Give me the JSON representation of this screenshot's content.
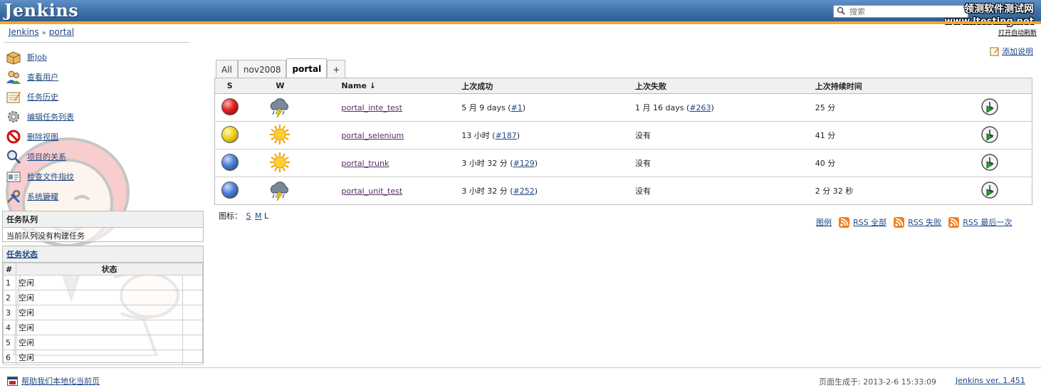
{
  "header": {
    "logo": "Jenkins",
    "search_placeholder": "搜索",
    "watermark_line1": "领测软件测试网",
    "watermark_line2": "www.ltesting.net"
  },
  "breadcrumb": {
    "root": "Jenkins",
    "separator": "»",
    "current": "portal"
  },
  "auto_refresh": "打开自动刷新",
  "sidebar": {
    "tasks": [
      {
        "label": "新Job",
        "icon": "new-package-icon"
      },
      {
        "label": "查看用户",
        "icon": "users-icon"
      },
      {
        "label": "任务历史",
        "icon": "notepad-icon"
      },
      {
        "label": "编辑任务列表",
        "icon": "gear-icon"
      },
      {
        "label": "删除视图",
        "icon": "no-entry-icon"
      },
      {
        "label": "项目的关系",
        "icon": "magnifier-icon"
      },
      {
        "label": "检查文件指纹",
        "icon": "fingerprint-card-icon"
      },
      {
        "label": "系统管理",
        "icon": "wrench-screwdriver-icon"
      }
    ],
    "queue": {
      "title": "任务队列",
      "message": "当前队列没有构建任务"
    },
    "executors": {
      "title": "任务状态",
      "col_num": "#",
      "col_status": "状态",
      "rows": [
        {
          "num": "1",
          "status": "空闲"
        },
        {
          "num": "2",
          "status": "空闲"
        },
        {
          "num": "3",
          "status": "空闲"
        },
        {
          "num": "4",
          "status": "空闲"
        },
        {
          "num": "5",
          "status": "空闲"
        },
        {
          "num": "6",
          "status": "空闲"
        }
      ]
    }
  },
  "main": {
    "add_description": "添加说明",
    "tabs": [
      "All",
      "nov2008",
      "portal",
      "+"
    ],
    "active_tab": "portal",
    "columns": {
      "s": "S",
      "w": "W",
      "name": "Name",
      "sort_arrow": "↓",
      "last_success": "上次成功",
      "last_failure": "上次失败",
      "last_duration": "上次持续时间"
    },
    "jobs": [
      {
        "ball": "red",
        "weather": "storm-icon",
        "name": "portal_inte_test",
        "ls_text": "5 月 9 days (",
        "ls_link": "#1",
        "ls_close": ")",
        "lf_text": "1 月 16 days (",
        "lf_link": "#263",
        "lf_close": ")",
        "duration": "25 分"
      },
      {
        "ball": "yellow",
        "weather": "sunny-icon",
        "name": "portal_selenium",
        "ls_text": "13 小时 (",
        "ls_link": "#187",
        "ls_close": ")",
        "lf_text": "没有",
        "lf_link": "",
        "lf_close": "",
        "duration": "41 分"
      },
      {
        "ball": "blue",
        "weather": "sunny-icon",
        "name": "portal_trunk",
        "ls_text": "3 小时 32 分 (",
        "ls_link": "#129",
        "ls_close": ")",
        "lf_text": "没有",
        "lf_link": "",
        "lf_close": "",
        "duration": "40 分"
      },
      {
        "ball": "blue",
        "weather": "storm-icon",
        "name": "portal_unit_test",
        "ls_text": "3 小时 32 分 (",
        "ls_link": "#252",
        "ls_close": ")",
        "lf_text": "没有",
        "lf_link": "",
        "lf_close": "",
        "duration": "2 分 32 秒"
      }
    ],
    "icon_size_label": "图标：",
    "icon_sizes": [
      "S",
      "M",
      "L"
    ],
    "legend": "图例",
    "rss": [
      "RSS 全部",
      "RSS 失败",
      "RSS 最后一次"
    ]
  },
  "footer": {
    "help": "帮助我们本地化当前页",
    "generated": "页面生成于: 2013-2-6 15:33:09",
    "version": "Jenkins ver. 1.451"
  },
  "colors": {
    "header_blue": "#3a6ea5",
    "accent_orange": "#f0a830",
    "rss_orange": "#f08020"
  }
}
